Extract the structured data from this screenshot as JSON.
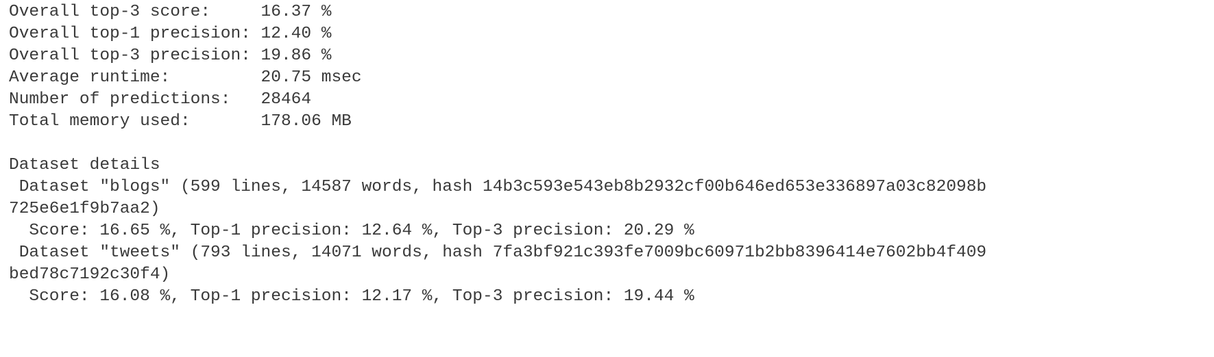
{
  "lines": [
    "Overall top-3 score:     16.37 %",
    "Overall top-1 precision: 12.40 %",
    "Overall top-3 precision: 19.86 %",
    "Average runtime:         20.75 msec",
    "Number of predictions:   28464",
    "Total memory used:       178.06 MB",
    "",
    "Dataset details",
    " Dataset \"blogs\" (599 lines, 14587 words, hash 14b3c593e543eb8b2932cf00b646ed653e336897a03c82098b",
    "725e6e1f9b7aa2)",
    "  Score: 16.65 %, Top-1 precision: 12.64 %, Top-3 precision: 20.29 %",
    " Dataset \"tweets\" (793 lines, 14071 words, hash 7fa3bf921c393fe7009bc60971b2bb8396414e7602bb4f409",
    "bed78c7192c30f4)",
    "  Score: 16.08 %, Top-1 precision: 12.17 %, Top-3 precision: 19.44 %"
  ]
}
